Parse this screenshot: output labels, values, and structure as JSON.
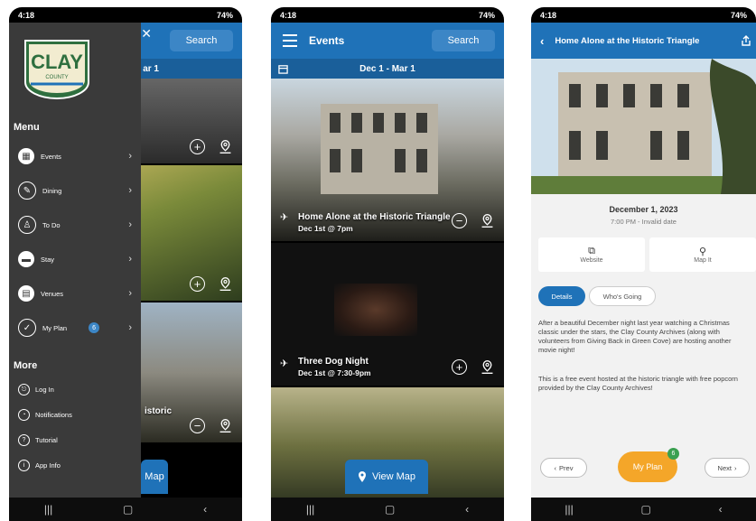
{
  "status": {
    "time": "4:18",
    "signal": "74%"
  },
  "colors": {
    "primary": "#1f72b8",
    "drawer": "#3a3a3a",
    "accent": "#f4a629"
  },
  "screen1": {
    "search_label": "Search",
    "date_partial": "ar 1",
    "card3_partial": "istoric",
    "viewmap_partial": "Map",
    "logo": {
      "text": "CLAY",
      "sub": "COUNTY"
    },
    "drawer": {
      "menu_heading": "Menu",
      "items": [
        {
          "label": "Events",
          "icon": "calendar-icon"
        },
        {
          "label": "Dining",
          "icon": "dining-icon"
        },
        {
          "label": "To Do",
          "icon": "hiker-icon"
        },
        {
          "label": "Stay",
          "icon": "bed-icon"
        },
        {
          "label": "Venues",
          "icon": "venue-icon"
        },
        {
          "label": "My Plan",
          "icon": "check-icon",
          "badge": "6"
        }
      ],
      "more_heading": "More",
      "more_items": [
        {
          "label": "Log In",
          "icon": "login-icon"
        },
        {
          "label": "Notifications",
          "icon": "bell-icon"
        },
        {
          "label": "Tutorial",
          "icon": "help-icon"
        },
        {
          "label": "App Info",
          "icon": "info-icon"
        }
      ]
    }
  },
  "screen2": {
    "title": "Events",
    "search_label": "Search",
    "date_range": "Dec 1 - Mar 1",
    "events": [
      {
        "title": "Home Alone at the Historic Triangle",
        "subtitle": "Dec 1st @ 7pm"
      },
      {
        "title": "Three Dog Night",
        "subtitle": "Dec 1st @ 7:30-9pm"
      }
    ],
    "view_map": "View Map"
  },
  "screen3": {
    "title": "Home Alone at the Historic Triangle",
    "date": "December 1, 2023",
    "time": "7:00 PM - Invalid date",
    "website_label": "Website",
    "mapit_label": "Map It",
    "tabs": [
      "Details",
      "Who's Going"
    ],
    "paragraph1": "After a beautiful December night last year watching a Christmas classic under the stars, the Clay County Archives (along with volunteers from Giving Back in Green Cove) are hosting another movie night!",
    "paragraph2": "This is a free event hosted at the historic triangle with free popcorn provided by the Clay County Archives!",
    "prev_label": "Prev",
    "myplan_label": "My Plan",
    "myplan_badge": "6",
    "next_label": "Next"
  },
  "nav": {
    "recents": "|||",
    "home": "▢",
    "back": "‹"
  }
}
